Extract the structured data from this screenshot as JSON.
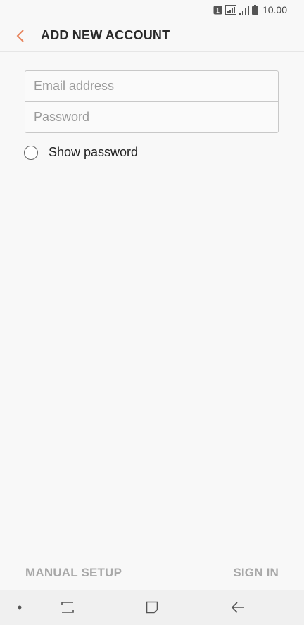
{
  "status_bar": {
    "sim_label": "1",
    "time": "10.00"
  },
  "header": {
    "title": "ADD NEW ACCOUNT"
  },
  "form": {
    "email_placeholder": "Email address",
    "email_value": "",
    "password_placeholder": "Password",
    "password_value": ""
  },
  "show_password": {
    "label": "Show password",
    "checked": false
  },
  "footer": {
    "manual_setup_label": "MANUAL SETUP",
    "sign_in_label": "SIGN IN"
  },
  "colors": {
    "accent": "#e8845c",
    "disabled_text": "#a8a8a8"
  },
  "icons": {
    "back": "chevron-left-icon",
    "nav_recents": "recents-icon",
    "nav_home": "home-icon",
    "nav_back": "back-arrow-icon"
  }
}
